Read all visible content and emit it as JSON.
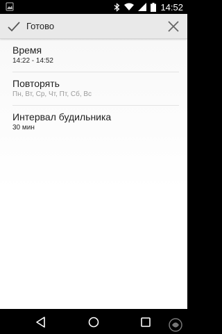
{
  "status_bar": {
    "time": "14:52",
    "icons": [
      "image-icon",
      "bluetooth-icon",
      "wifi-icon",
      "signal-icon",
      "battery-icon"
    ]
  },
  "action_bar": {
    "done_label": "Готово",
    "done_icon": "check-icon",
    "close_icon": "close-icon"
  },
  "settings": [
    {
      "title": "Время",
      "summary": "14:22 - 14:52"
    },
    {
      "title": "Повторять",
      "summary": "Пн, Вт, Ср, Чт, Пт, Сб, Вс"
    },
    {
      "title": "Интервал будильника",
      "summary": "30 мин"
    }
  ],
  "nav_bar": {
    "icons": [
      "back-icon",
      "home-icon",
      "recent-apps-icon"
    ]
  },
  "colors": {
    "action_bar_bg": "#e9e9e9",
    "content_bg": "#f7f7f7",
    "system_bars": "#000000",
    "muted_text": "#9a9a9a"
  }
}
